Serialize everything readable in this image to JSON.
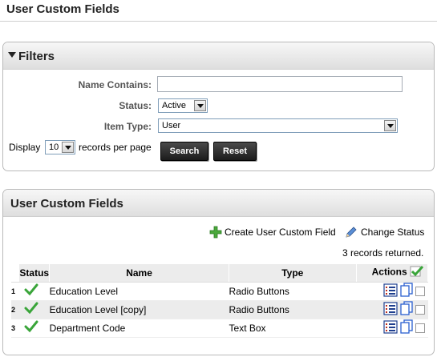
{
  "page": {
    "title": "User Custom Fields"
  },
  "filters": {
    "title": "Filters",
    "name_label": "Name Contains:",
    "name_value": "",
    "status_label": "Status:",
    "status_value": "Active",
    "item_type_label": "Item Type:",
    "item_type_value": "User",
    "display_label": "Display",
    "display_value": "10",
    "per_page_label": "records per page",
    "search_label": "Search",
    "reset_label": "Reset"
  },
  "results": {
    "title": "User Custom Fields",
    "create_label": "Create User Custom Field",
    "change_status_label": "Change Status",
    "records_text": "3 records returned.",
    "columns": {
      "status": "Status",
      "name": "Name",
      "type": "Type",
      "actions": "Actions"
    },
    "rows": [
      {
        "num": "1",
        "name": "Education Level",
        "type": "Radio Buttons"
      },
      {
        "num": "2",
        "name": "Education Level [copy]",
        "type": "Radio Buttons"
      },
      {
        "num": "3",
        "name": "Department Code",
        "type": "Text Box"
      }
    ]
  },
  "colors": {
    "check_green": "#3aa53a",
    "button_dark": "#2a2a2a",
    "header_grey": "#ececec"
  }
}
